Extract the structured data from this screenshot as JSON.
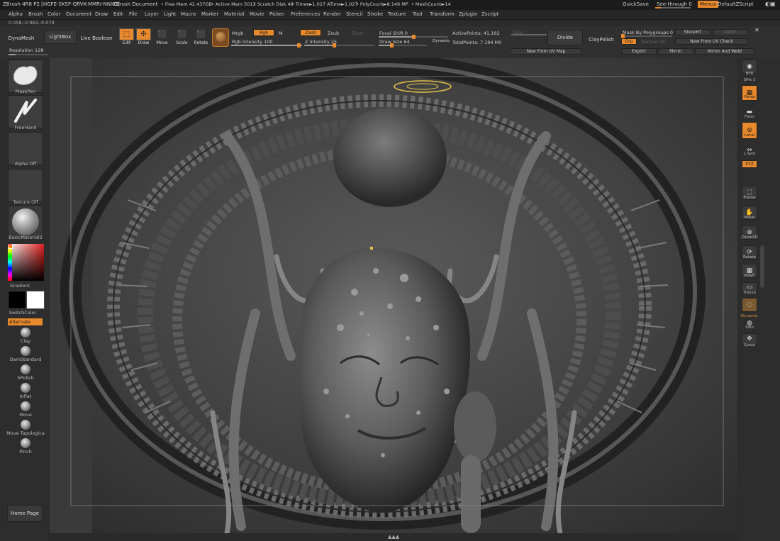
{
  "title": {
    "app": "ZBrush 4R8 P2 [HGFE-SKSF-QRVK-MMRI-NNXG]",
    "document": "ZBrush Document",
    "free_mem": "• Free Mem 42.437GB",
    "active_mem": "• Active Mem 5013",
    "scratch": "• Scratch Disk 48",
    "timer": "• Timer►1.027 ATime►1.027",
    "polycount": "• PolyCount►8.149 MP",
    "meshcount": "• MeshCount►14",
    "quicksave": "QuickSave",
    "seethrough": "See-through  0",
    "menus": "Menus",
    "defaultzscript": "DefaultZScript"
  },
  "menu": [
    "Alpha",
    "Brush",
    "Color",
    "Document",
    "Draw",
    "Edit",
    "File",
    "Layer",
    "Light",
    "Macro",
    "Marker",
    "Material",
    "Movie",
    "Picker",
    "Preferences",
    "Render",
    "Stencil",
    "Stroke",
    "Texture",
    "Tool",
    "Transform",
    "Zplugin",
    "Zscript"
  ],
  "coords": "0.058,-0.963,-0.079",
  "shelf": {
    "dynamesh": "DynaMesh",
    "lightbox": "LightBox",
    "liveboolean": "Live Boolean",
    "resolution": "Resolution 128",
    "edit": "Edit",
    "draw": "Draw",
    "move": "Move",
    "scale": "Scale",
    "rotate": "Rotate",
    "mrgb": "Mrgb",
    "rgb": "Rgb",
    "m": "M",
    "zadd": "Zadd",
    "zsub": "Zsub",
    "zcut": "Zcut",
    "rgb_intensity": "Rgb Intensity 100",
    "z_intensity": "Z Intensity 25",
    "focal_shift": "Focal Shift 0",
    "draw_size": "Draw Size 64",
    "dynamic": "Dynamic",
    "active_points": "ActivePoints: 41,192",
    "total_points": "TotalPoints: 7.194 Mil",
    "sdiv": "SDiv",
    "divide": "Divide",
    "claypolish": "ClayPolish",
    "new_from_uv_map": "New From UV Map",
    "mask_by_polygroups": "Mask By Polygroups 0",
    "storemt": "StoreMT",
    "delmt": "DelMT",
    "grp": "Grp",
    "texture_on": "Texture On",
    "new_from_uv_check": "New From UV Check",
    "export": "Export",
    "mirror": "Mirror",
    "mirror_and_weld": "Mirror And Weld"
  },
  "left": {
    "maskpen": "MaskPen",
    "freehand": "FreeHand",
    "alpha_off": "Alpha Off",
    "texture_off": "Texture Off",
    "material": "BasicMaterial2",
    "gradient": "Gradient",
    "switchcolor": "SwitchColor",
    "alternate": "Alternate",
    "brushes": [
      "Clay",
      "DamStandard",
      "hPolish",
      "Inflat",
      "Move",
      "Move Topologica",
      "Pinch"
    ],
    "home_page": "Home Page"
  },
  "right": {
    "bpr": "BPR",
    "spix": "SPix 3",
    "persp": "Persp",
    "floor": "Floor",
    "local": "Local",
    "lsym": "L.Sym",
    "xyz": "XYZ",
    "frame": "Frame",
    "move": "Move",
    "zoom3d": "Zoom3D",
    "rotate": "Rotate",
    "polyf": "PolyF",
    "transp": "Transp",
    "dynamic": "Dynamic",
    "solo": "Solo",
    "xpose": "Xpose"
  },
  "colors": {
    "accent": "#e7892c",
    "bg": "#2b2b2b",
    "panel": "#303030"
  }
}
